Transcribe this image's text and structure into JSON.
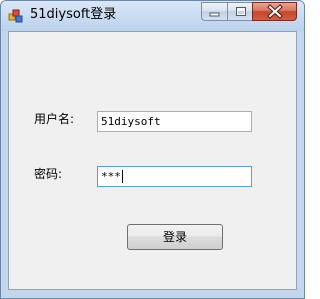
{
  "window": {
    "title": "51diysoft登录",
    "controls": {
      "minimize_icon": "minimize-icon",
      "maximize_icon": "maximize-icon",
      "close_icon": "close-icon"
    }
  },
  "form": {
    "username_label": "用户名:",
    "username_value": "51diysoft",
    "password_label": "密码:",
    "password_value": "***",
    "login_button": "登录"
  },
  "colors": {
    "title_bar": "#c9dcf2",
    "client_bg": "#f0f0f0",
    "close_button": "#c7472c",
    "focus_border": "#569de5"
  }
}
